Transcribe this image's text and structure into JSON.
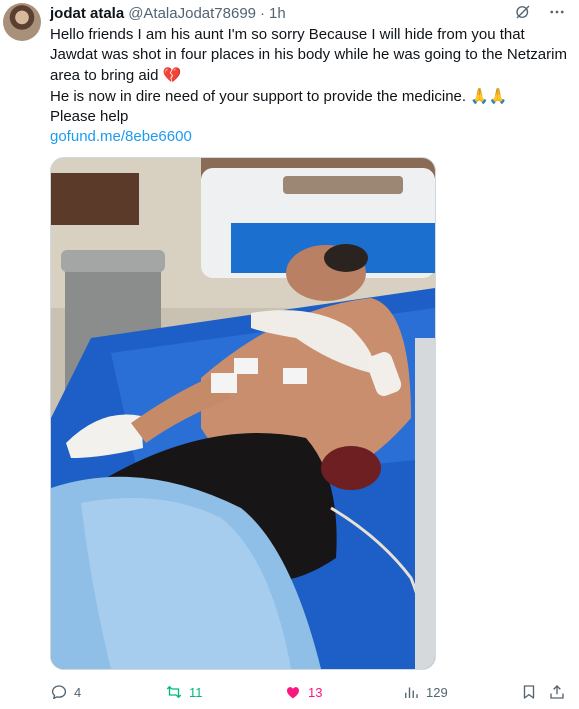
{
  "author": {
    "display_name": "jodat atala",
    "handle": "@AtalaJodat78699",
    "separator": "·",
    "time": "1h"
  },
  "tweet": {
    "line1": "Hello friends I am his aunt I'm so sorry Because I will hide from you that Jawdat was shot in four places in his body while he was going to the Netzarim area to bring aid",
    "line1_emoji": "💔",
    "line2": "He is now in dire need of your support to provide the medicine.",
    "line2_emoji": "🙏🙏",
    "line3": "Please help",
    "link": "gofund.me/8ebe6600"
  },
  "stats": {
    "replies": "4",
    "retweets": "11",
    "likes": "13",
    "views": "129"
  },
  "icons": {
    "header": [
      "grok-icon",
      "more-icon"
    ],
    "actions": [
      "reply-icon",
      "retweet-icon",
      "like-icon",
      "views-icon",
      "bookmark-icon",
      "share-icon"
    ]
  },
  "colors": {
    "link": "#1d9bf0",
    "secondary_text": "#536471",
    "retweet": "#00ba7c",
    "like": "#f91880"
  }
}
